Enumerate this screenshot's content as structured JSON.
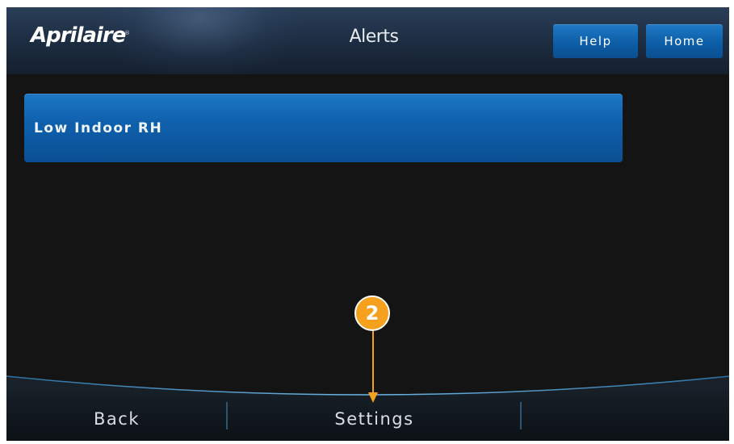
{
  "header": {
    "logo_text": "Aprilaire",
    "logo_mark": "®",
    "title": "Alerts",
    "help_label": "Help",
    "home_label": "Home"
  },
  "alerts": {
    "items": [
      {
        "label": "Low Indoor RH"
      }
    ]
  },
  "footer": {
    "back_label": "Back",
    "settings_label": "Settings",
    "third_label": ""
  },
  "callout": {
    "number": "2"
  },
  "colors": {
    "accent_blue": "#0f61ae",
    "callout_orange": "#f5a11d",
    "background": "#141414"
  }
}
